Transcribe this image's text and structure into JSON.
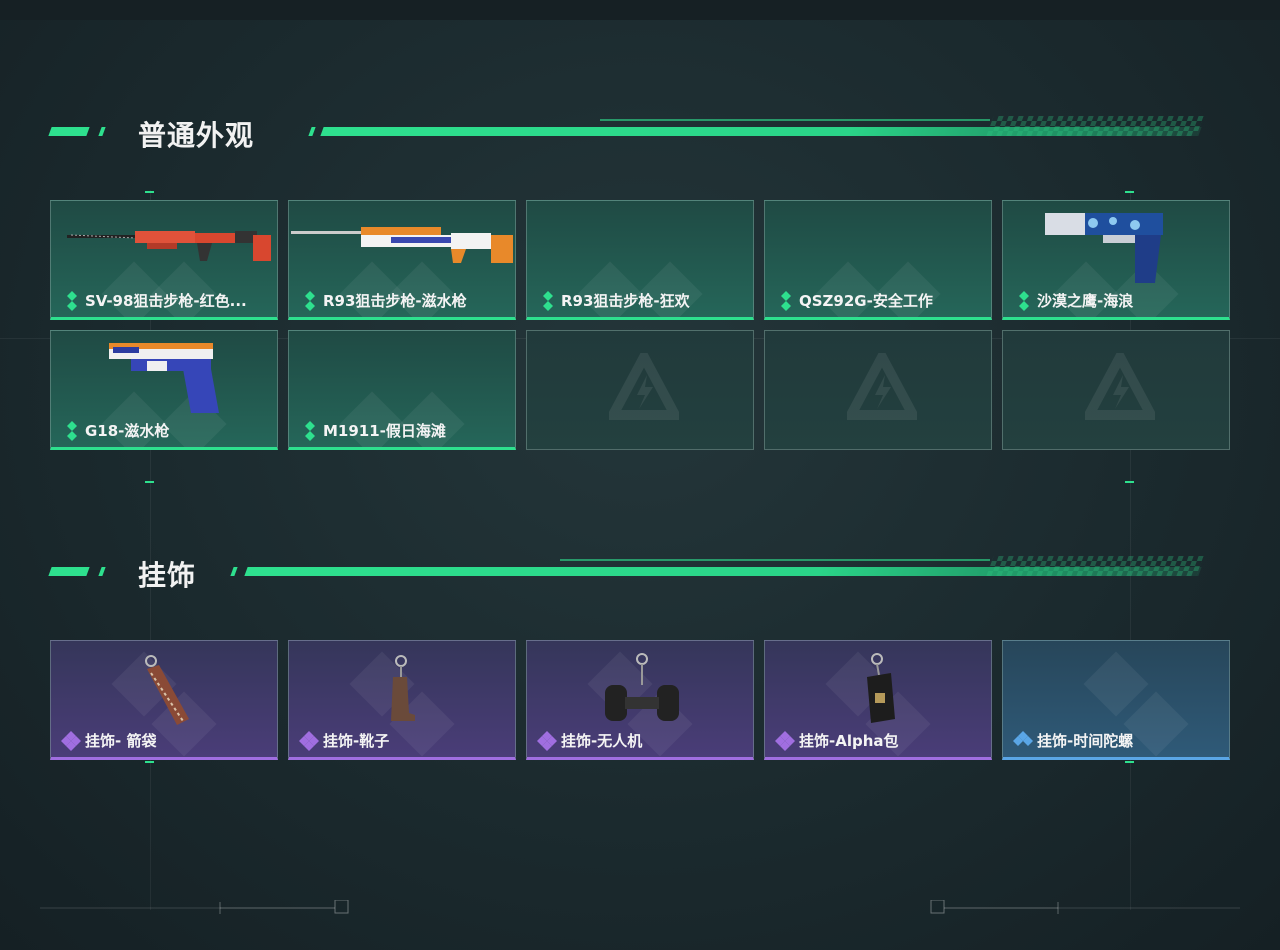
{
  "sections": {
    "skins": {
      "title": "普通外观",
      "items": [
        {
          "label": "SV-98狙击步枪-红色...",
          "art": "sniper-rifle-red-icon"
        },
        {
          "label": "R93狙击步枪-滋水枪",
          "art": "sniper-rifle-watergun-icon"
        },
        {
          "label": "R93狙击步枪-狂欢",
          "art": ""
        },
        {
          "label": "QSZ92G-安全工作",
          "art": ""
        },
        {
          "label": "沙漠之鹰-海浪",
          "art": "desert-eagle-wave-icon"
        },
        {
          "label": "G18-滋水枪",
          "art": "pistol-watergun-icon"
        },
        {
          "label": "M1911-假日海滩",
          "art": ""
        }
      ]
    },
    "charms": {
      "title": "挂饰",
      "items": [
        {
          "label": "挂饰- 箭袋",
          "art": "quiver-charm-icon"
        },
        {
          "label": "挂饰-靴子",
          "art": "boot-charm-icon"
        },
        {
          "label": "挂饰-无人机",
          "art": "drone-charm-icon"
        },
        {
          "label": "挂饰-Alpha包",
          "art": "alpha-bag-charm-icon"
        },
        {
          "label": "挂饰-时间陀螺",
          "art": ""
        }
      ]
    }
  },
  "colors": {
    "accent": "#2ee08e",
    "rarity_green": "#2ee08e",
    "rarity_purple": "#a06ee0",
    "rarity_blue": "#5aa6e6"
  }
}
